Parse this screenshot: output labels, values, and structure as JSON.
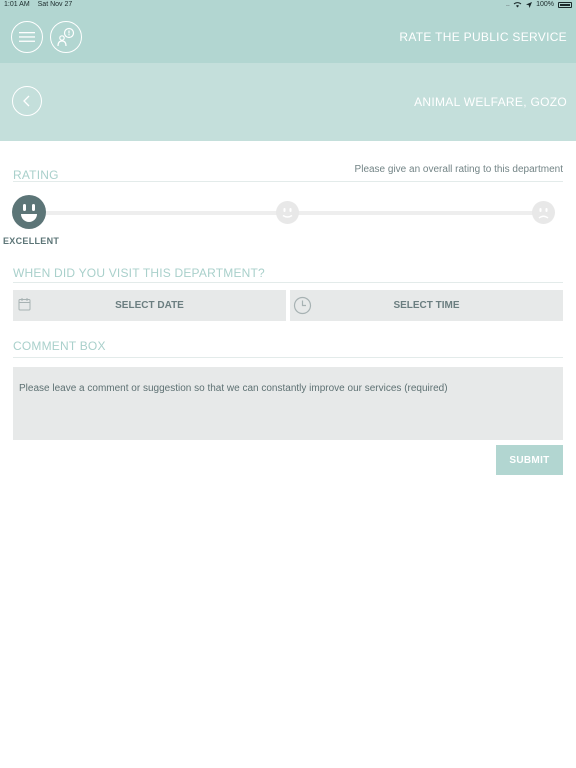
{
  "status_bar": {
    "time": "1:01 AM",
    "date": "Sat Nov 27",
    "signal": "....",
    "battery_percent": "100%"
  },
  "header": {
    "title": "RATE THE PUBLIC SERVICE",
    "menu_icon": "hamburger-icon",
    "rate_icon": "person-speech-icon"
  },
  "subheader": {
    "back_icon": "chevron-left-icon",
    "department": "ANIMAL WELFARE, GOZO"
  },
  "rating": {
    "label": "RATING",
    "hint": "Please give an overall rating to this department",
    "options": [
      {
        "name": "EXCELLENT",
        "icon": "smile-face-icon",
        "selected": true
      },
      {
        "name": "",
        "icon": "neutral-face-icon",
        "selected": false
      },
      {
        "name": "",
        "icon": "sad-face-icon",
        "selected": false
      }
    ],
    "selected_label": "EXCELLENT"
  },
  "visit": {
    "label": "WHEN DID YOU VISIT THIS DEPARTMENT?",
    "date_label": "SELECT DATE",
    "time_label": "SELECT TIME",
    "date_icon": "calendar-icon",
    "time_icon": "clock-icon"
  },
  "comment": {
    "label": "COMMENT BOX",
    "placeholder": "Please leave a comment or suggestion so that we can constantly improve our services (required)"
  },
  "submit_label": "SUBMIT",
  "colors": {
    "accent": "#b2d6d1",
    "subheader": "#c4dfdb",
    "selected_face": "#5c7577",
    "field_bg": "#e7e9e9"
  }
}
